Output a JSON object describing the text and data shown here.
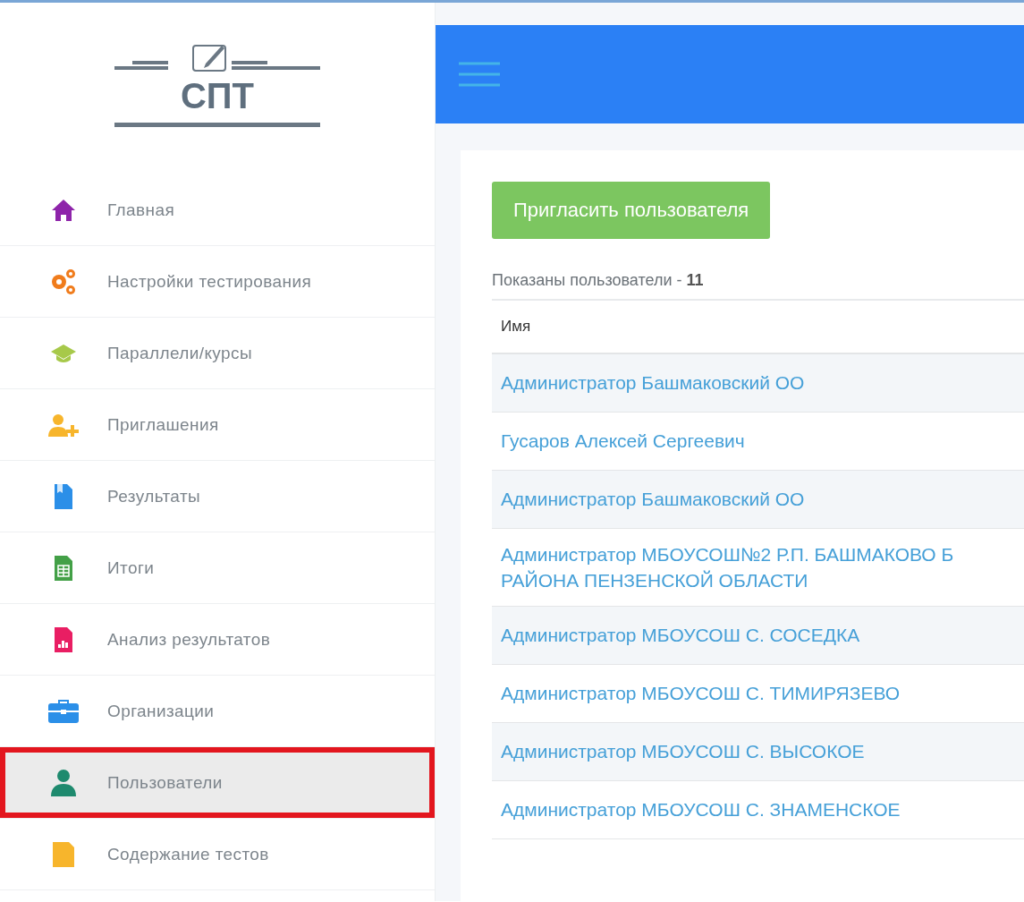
{
  "logo": {
    "text": "СПТ"
  },
  "sidebar": {
    "items": [
      {
        "label": "Главная",
        "selected": false
      },
      {
        "label": "Настройки тестирования",
        "selected": false
      },
      {
        "label": "Параллели/курсы",
        "selected": false
      },
      {
        "label": "Приглашения",
        "selected": false
      },
      {
        "label": "Результаты",
        "selected": false
      },
      {
        "label": "Итоги",
        "selected": false
      },
      {
        "label": "Анализ результатов",
        "selected": false
      },
      {
        "label": "Организации",
        "selected": false
      },
      {
        "label": "Пользователи",
        "selected": true
      },
      {
        "label": "Содержание тестов",
        "selected": false
      }
    ]
  },
  "invite_button": "Пригласить пользователя",
  "count": "Показаны пользователи - **11**",
  "table": {
    "columns": [
      "Имя"
    ],
    "rows": [
      "Администратор Башмаковский ОО",
      "Гусаров Алексей Сергеевич",
      "Администратор Башмаковский ОО",
      "Администратор МБОУСОШ№2 Р.П. БАШМАКОВО Б\nРАЙОНА ПЕНЗЕНСКОЙ ОБЛАСТИ",
      "Администратор МБОУСОШ С. СОСЕДКА",
      "Администратор МБОУСОШ С. ТИМИРЯЗЕВО",
      "Администратор МБОУСОШ С. ВЫСОКОЕ",
      "Администратор МБОУСОШ С. ЗНАМЕНСКОЕ"
    ]
  }
}
